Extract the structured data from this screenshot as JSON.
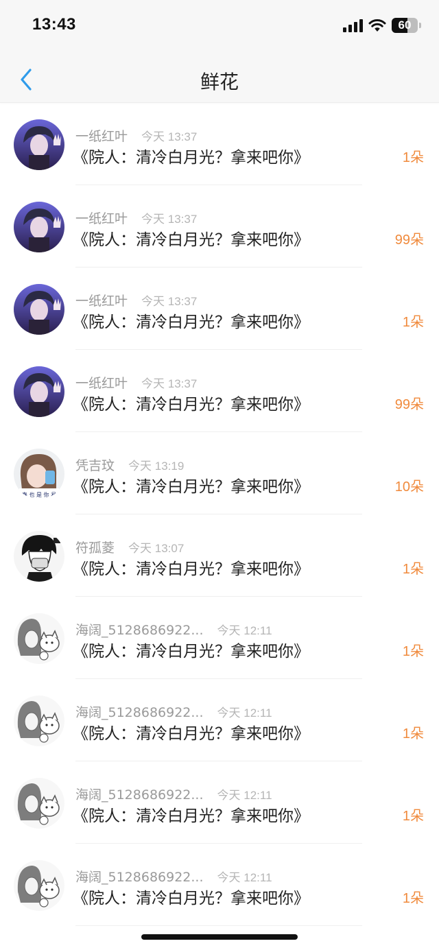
{
  "status_bar": {
    "time": "13:43",
    "battery": "60",
    "battery_level": 0.6
  },
  "header": {
    "title": "鲜花"
  },
  "colors": {
    "accent": "#2f9bea",
    "count": "#f08a3c"
  },
  "flowers": [
    {
      "username": "一纸红叶",
      "time": "今天 13:37",
      "message": "《院人：清冷白月光？拿来吧你》",
      "amount": "1",
      "unit": "朵",
      "avatar": "purple-portrait"
    },
    {
      "username": "一纸红叶",
      "time": "今天 13:37",
      "message": "《院人：清冷白月光？拿来吧你》",
      "amount": "99",
      "unit": "朵",
      "avatar": "purple-portrait"
    },
    {
      "username": "一纸红叶",
      "time": "今天 13:37",
      "message": "《院人：清冷白月光？拿来吧你》",
      "amount": "1",
      "unit": "朵",
      "avatar": "purple-portrait"
    },
    {
      "username": "一纸红叶",
      "time": "今天 13:37",
      "message": "《院人：清冷白月光？拿来吧你》",
      "amount": "99",
      "unit": "朵",
      "avatar": "purple-portrait"
    },
    {
      "username": "凭吉玟",
      "time": "今天 13:19",
      "message": "《院人：清冷白月光？拿来吧你》",
      "amount": "10",
      "unit": "朵",
      "avatar": "girl-photo"
    },
    {
      "username": "符孤菱",
      "time": "今天 13:07",
      "message": "《院人：清冷白月光？拿来吧你》",
      "amount": "1",
      "unit": "朵",
      "avatar": "manga-boy"
    },
    {
      "username": "海阔_5128686922...",
      "time": "今天 12:11",
      "message": "《院人：清冷白月光？拿来吧你》",
      "amount": "1",
      "unit": "朵",
      "avatar": "sketch-girl-cat"
    },
    {
      "username": "海阔_5128686922...",
      "time": "今天 12:11",
      "message": "《院人：清冷白月光？拿来吧你》",
      "amount": "1",
      "unit": "朵",
      "avatar": "sketch-girl-cat"
    },
    {
      "username": "海阔_5128686922...",
      "time": "今天 12:11",
      "message": "《院人：清冷白月光？拿来吧你》",
      "amount": "1",
      "unit": "朵",
      "avatar": "sketch-girl-cat"
    },
    {
      "username": "海阔_5128686922...",
      "time": "今天 12:11",
      "message": "《院人：清冷白月光？拿来吧你》",
      "amount": "1",
      "unit": "朵",
      "avatar": "sketch-girl-cat"
    }
  ]
}
